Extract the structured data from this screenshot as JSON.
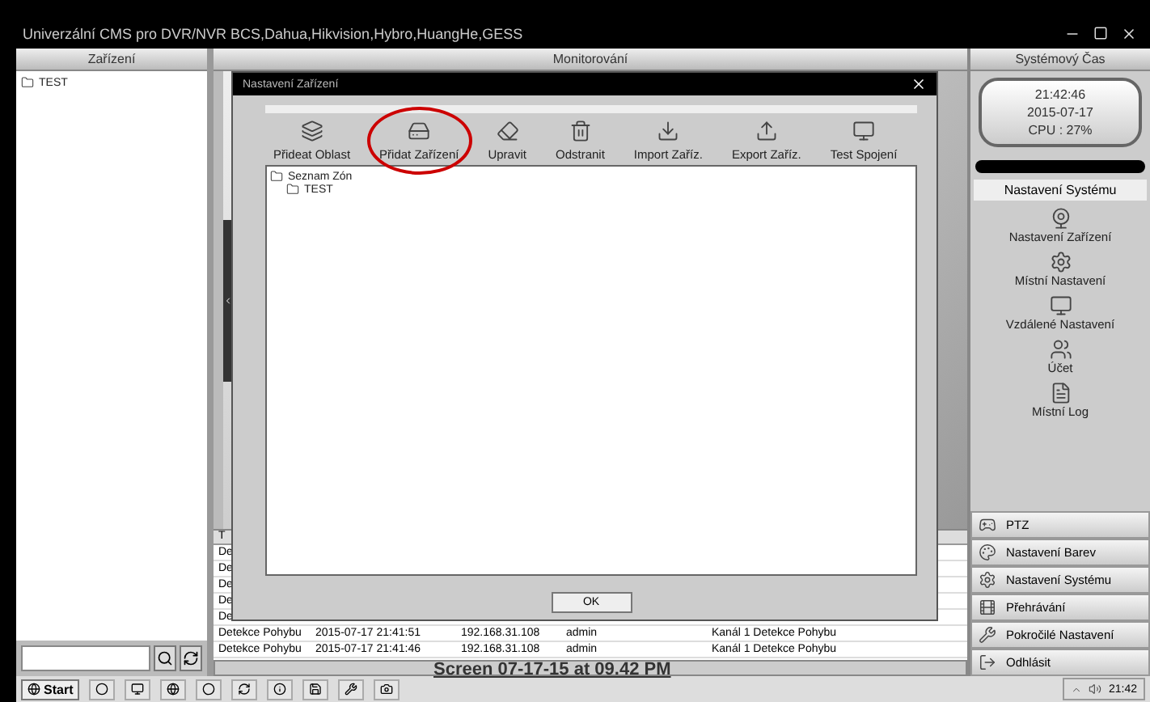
{
  "window": {
    "title": "Univerzální CMS pro DVR/NVR BCS,Dahua,Hikvision,Hybro,HuangHe,GESS"
  },
  "panels": {
    "left": "Zařízení",
    "center": "Monitorování",
    "right": "Systémový Čas"
  },
  "device_tree": [
    {
      "label": "TEST"
    }
  ],
  "clock": {
    "time": "21:42:46",
    "date": "2015-07-17",
    "cpu": "CPU : 27%"
  },
  "system_menu": {
    "title": "Nastavení Systému",
    "items": [
      {
        "kind": "camera",
        "label": "Nastavení Zařízení"
      },
      {
        "kind": "local",
        "label": "Místní Nastavení"
      },
      {
        "kind": "remote",
        "label": "Vzdálené Nastavení"
      },
      {
        "kind": "users",
        "label": "Účet"
      },
      {
        "kind": "log",
        "label": "Místní Log"
      }
    ]
  },
  "action_buttons": [
    {
      "kind": "ptz",
      "label": "PTZ"
    },
    {
      "kind": "color",
      "label": "Nastavení Barev"
    },
    {
      "kind": "system",
      "label": "Nastavení Systému"
    },
    {
      "kind": "playback",
      "label": "Přehrávání"
    },
    {
      "kind": "advanced",
      "label": "Pokročilé Nastavení"
    },
    {
      "kind": "logout",
      "label": "Odhlásit"
    }
  ],
  "event_log": {
    "column_1": "T",
    "rows": [
      [
        "De"
      ],
      [
        "De"
      ],
      [
        "De"
      ],
      [
        "De"
      ],
      [
        "De"
      ],
      [
        "Detekce Pohybu",
        "2015-07-17 21:41:51",
        "192.168.31.108",
        "admin",
        "Kanál 1 Detekce Pohybu"
      ],
      [
        "Detekce Pohybu",
        "2015-07-17 21:41:46",
        "192.168.31.108",
        "admin",
        "Kanál 1 Detekce Pohybu"
      ]
    ]
  },
  "dialog": {
    "title": "Nastavení Zařízení",
    "toolbar": [
      {
        "kind": "area",
        "label": "Přideat Oblast",
        "circled": false
      },
      {
        "kind": "device",
        "label": "Přidat Zařízení",
        "circled": true
      },
      {
        "kind": "edit",
        "label": "Upravit",
        "circled": false
      },
      {
        "kind": "delete",
        "label": "Odstranit",
        "circled": false
      },
      {
        "kind": "import",
        "label": "Import Zaříz.",
        "circled": false
      },
      {
        "kind": "export",
        "label": "Export Zaříz.",
        "circled": false
      },
      {
        "kind": "test",
        "label": "Test Spojení",
        "circled": false
      }
    ],
    "tree": {
      "label": "Seznam Zón",
      "children": [
        {
          "label": "TEST"
        }
      ]
    },
    "ok": "OK"
  },
  "caption": "Screen 07-17-15 at 09.42 PM",
  "taskbar": {
    "start": "Start",
    "clock": "21:42"
  }
}
